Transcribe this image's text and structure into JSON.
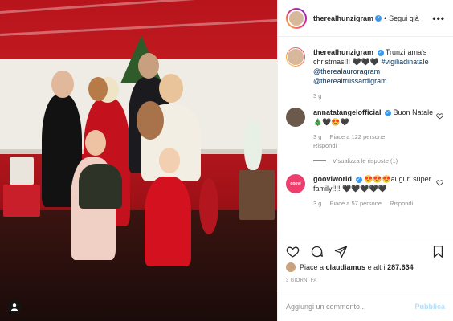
{
  "header": {
    "username": "therealhunzigram",
    "verified": true,
    "separator": "•",
    "follow_label": "Segui già",
    "more_label": "•••"
  },
  "caption": {
    "username": "therealhunzigram",
    "text": "Trunzirama's christmas!!! 🖤🖤🖤",
    "hashtag": "#vigiliadinatale",
    "mentions": [
      "@therealauroragram",
      "@therealtrussardigram"
    ],
    "time": "3 g"
  },
  "comments": [
    {
      "username": "annatatangelofficial",
      "verified": true,
      "text": "Buon Natale🎄🖤😍🖤",
      "time": "3 g",
      "likes": "Piace a 122 persone",
      "reply_label": "Rispondi",
      "view_replies": "Visualizza le risposte (1)"
    },
    {
      "username": "gooviworld",
      "verified": true,
      "text": "😍😍😍auguri super family!!!! 🖤🖤🖤🖤🖤",
      "time": "3 g",
      "likes": "Piace a 57 persone",
      "reply_label": "Rispondi",
      "avatar_text": "goovi"
    }
  ],
  "likes": {
    "prefix": "Piace a",
    "user": "claudiamus",
    "suffix": "e altri",
    "count": "287.634"
  },
  "date": "3 GIORNI FA",
  "add_comment": {
    "placeholder": "Aggiungi un commento...",
    "publish_label": "Pubblica"
  },
  "icons": {
    "like": "heart-icon",
    "comment": "comment-icon",
    "share": "paper-plane-icon",
    "save": "bookmark-icon",
    "more": "more-dots-icon",
    "tagged": "person-tag-icon"
  },
  "colors": {
    "verified": "#3897f0",
    "link": "#00376b",
    "muted": "#8e8e8e",
    "publish_disabled": "#b2dffc"
  }
}
